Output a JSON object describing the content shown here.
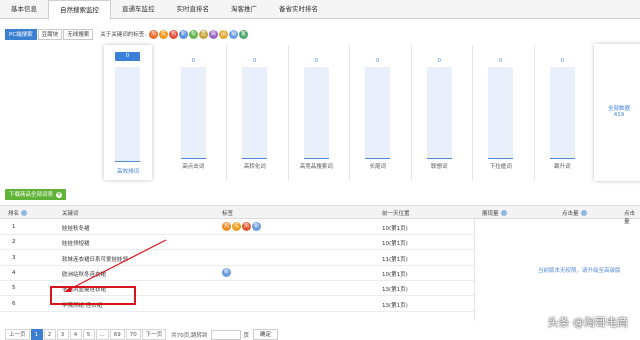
{
  "tabs": [
    {
      "label": "基本信息",
      "active": false
    },
    {
      "label": "自然搜索监控",
      "active": true
    },
    {
      "label": "直通车监控",
      "active": false
    },
    {
      "label": "实时直排名",
      "active": false
    },
    {
      "label": "淘客推广",
      "active": false
    },
    {
      "label": "备省实时排名",
      "active": false
    }
  ],
  "filters": {
    "options": [
      {
        "label": "PC端搜索",
        "active": true
      },
      {
        "label": "豆腐块",
        "active": false
      },
      {
        "label": "无线搜索",
        "active": false
      }
    ],
    "keyword_tag_label": "关于关键词的标签:",
    "badges": [
      {
        "text": "热",
        "color": "#ef6b2b"
      },
      {
        "text": "优",
        "color": "#f29b1d"
      },
      {
        "text": "热",
        "color": "#e54d3c"
      },
      {
        "text": "新",
        "color": "#5b8fdc"
      },
      {
        "text": "标",
        "color": "#64b54e"
      },
      {
        "text": "直",
        "color": "#c7a23b"
      },
      {
        "text": "飙",
        "color": "#9a67c9"
      },
      {
        "text": "品",
        "color": "#e2a72d"
      },
      {
        "text": "销",
        "color": "#6aa0df"
      },
      {
        "text": "客",
        "color": "#4da66c"
      }
    ]
  },
  "chart_data": {
    "type": "bar",
    "categories": [
      "高效排词",
      "高点击词",
      "高转化词",
      "高竞品搜索词",
      "长尾词",
      "联想词",
      "下拉框词",
      "飙升词"
    ],
    "values": [
      0,
      0,
      0,
      0,
      0,
      0,
      0,
      0
    ],
    "selected_category": "高效排词",
    "total_label": "全部数据",
    "total_value": "419"
  },
  "download_button": {
    "label": "下载商品全部词表",
    "icon": "plus-circle-icon"
  },
  "table": {
    "headers": {
      "rank": "排名",
      "keyword": "关键词",
      "tags": "标签",
      "prev_position": "前一天位置",
      "exposure": "展现量",
      "clicks1": "点击量",
      "clicks2": "点击量"
    },
    "rows": [
      {
        "rank": "1",
        "keyword": "娃娃秋冬裙",
        "tags": [
          "热",
          "优",
          "热",
          "新"
        ],
        "prev": "10(第1页)"
      },
      {
        "rank": "2",
        "keyword": "娃娃领短裙",
        "tags": [],
        "prev": "10(第1页)"
      },
      {
        "rank": "3",
        "keyword": "软妹连衣裙日系可爱娃娃领",
        "tags": [],
        "prev": "11(第1页)"
      },
      {
        "rank": "4",
        "keyword": "欧洲站秋冬连衣裙",
        "tags": [
          "新"
        ],
        "prev": "10(第1页)"
      },
      {
        "rank": "5",
        "keyword": "学院风显瘦连衣裙",
        "tags": [],
        "prev": "13(第1页)"
      },
      {
        "rank": "6",
        "keyword": "学院风裙 连衣裙",
        "tags": [],
        "prev": "13(第1页)"
      }
    ],
    "no_permission_text": "当前版本无权限，请升级至高级版"
  },
  "pagination": {
    "prev": "上一页",
    "pages": [
      "1",
      "2",
      "3",
      "4",
      "5",
      "...",
      "69",
      "70"
    ],
    "next": "下一页",
    "info": "共70页,跳转到",
    "unit": "页",
    "go": "确定"
  },
  "watermark": "头条 @淘哥电商"
}
